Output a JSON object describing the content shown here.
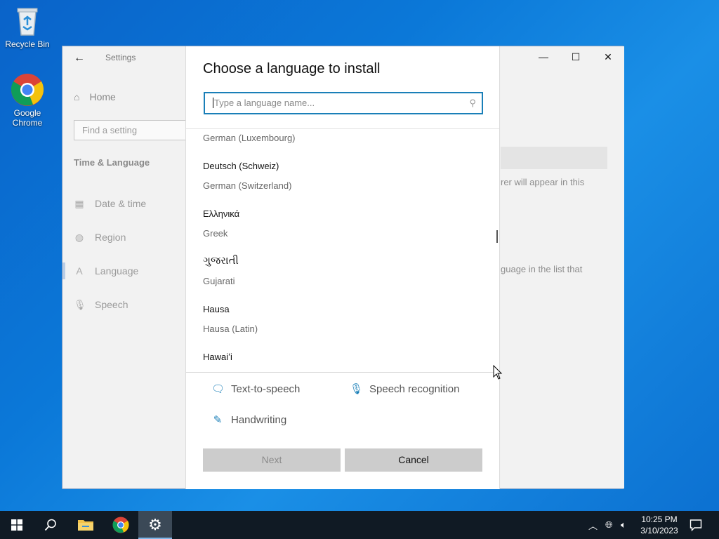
{
  "desktop": {
    "icons": [
      {
        "label": "Recycle Bin"
      },
      {
        "label": "Google Chrome"
      }
    ]
  },
  "settings": {
    "title": "Settings",
    "home": "Home",
    "find_placeholder": "Find a setting",
    "section": "Time & Language",
    "nav": [
      {
        "label": "Date & time",
        "icon": "calendar-icon"
      },
      {
        "label": "Region",
        "icon": "globe-icon"
      },
      {
        "label": "Language",
        "icon": "language-icon"
      },
      {
        "label": "Speech",
        "icon": "microphone-icon"
      }
    ],
    "right_text_1": "rer will appear in this",
    "right_text_2": "guage in the list that"
  },
  "dialog": {
    "title": "Choose a language to install",
    "search_placeholder": "Type a language name...",
    "languages": [
      {
        "native": "",
        "english": "German (Luxembourg)"
      },
      {
        "native": "Deutsch (Schweiz)",
        "english": "German (Switzerland)"
      },
      {
        "native": "Ελληνικά",
        "english": "Greek"
      },
      {
        "native": "ગુજરાતી",
        "english": "Gujarati"
      },
      {
        "native": "Hausa",
        "english": "Hausa (Latin)"
      },
      {
        "native": "Hawaiʻi",
        "english": ""
      }
    ],
    "features": {
      "tts": "Text-to-speech",
      "speech": "Speech recognition",
      "handwriting": "Handwriting"
    },
    "next_label": "Next",
    "cancel_label": "Cancel"
  },
  "taskbar": {
    "time": "10:25 PM",
    "date": "3/10/2023"
  }
}
